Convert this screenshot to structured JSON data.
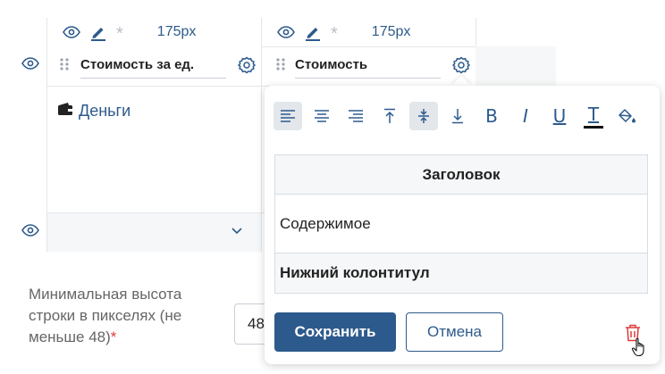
{
  "columns": [
    {
      "width_label": "175px",
      "name": "Стоимость за ед."
    },
    {
      "width_label": "175px",
      "name": "Стоимость"
    }
  ],
  "asterisk": "*",
  "cell_value": "Деньги",
  "popover": {
    "toolbar": {
      "bold": "B",
      "italic": "I",
      "underline": "U",
      "text_color": "T"
    },
    "preview": {
      "header": "Заголовок",
      "body": "Содержимое",
      "footer": "Нижний колонтитул"
    },
    "save_label": "Сохранить",
    "cancel_label": "Отмена"
  },
  "min_height": {
    "label": "Минимальная высота строки в пикселях (не меньше 48)",
    "required_mark": "*",
    "value": "48"
  },
  "colors": {
    "accent": "#2d5a8c",
    "danger": "#e03a3a",
    "border": "#d7dde3",
    "active_tool_bg": "#e3e7eb"
  }
}
